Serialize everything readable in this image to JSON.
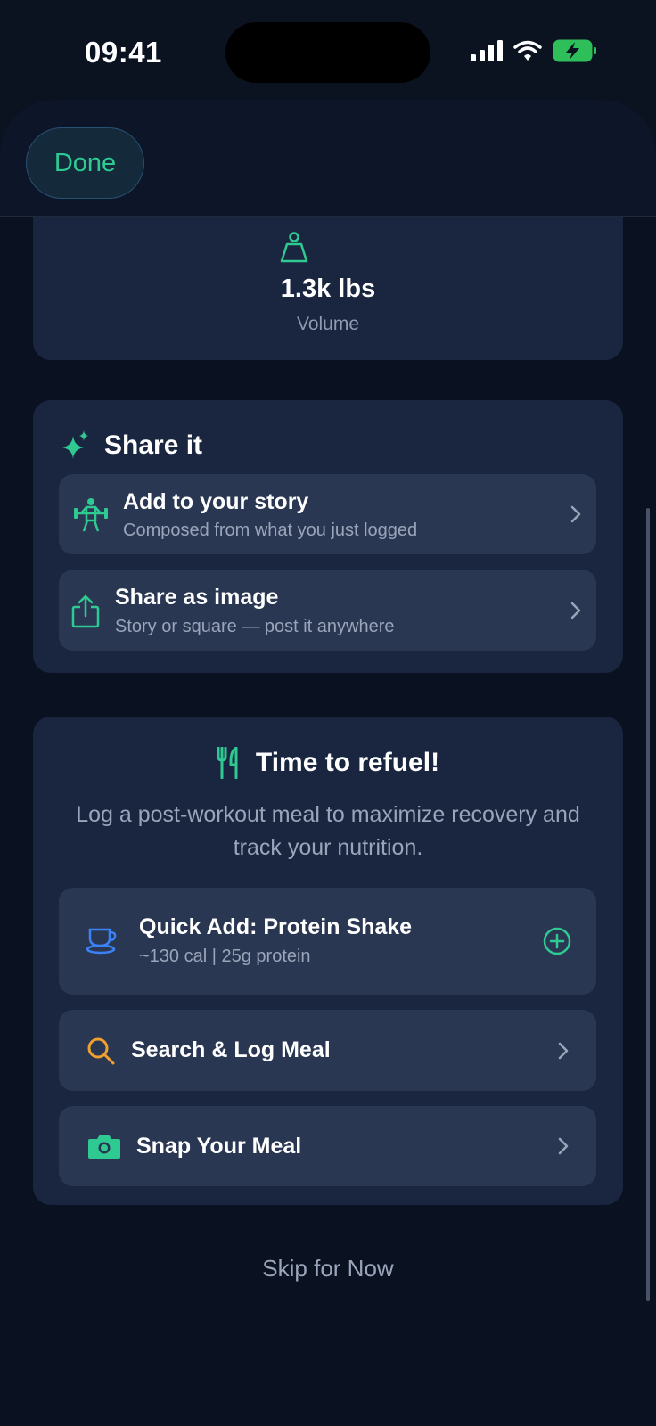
{
  "status": {
    "time": "09:41"
  },
  "header": {
    "done_label": "Done"
  },
  "volume": {
    "value": "1.3k lbs",
    "label": "Volume"
  },
  "share": {
    "title": "Share it",
    "story": {
      "title": "Add to your story",
      "subtitle": "Composed from what you just logged"
    },
    "image": {
      "title": "Share as image",
      "subtitle": "Story or square — post it anywhere"
    }
  },
  "refuel": {
    "title": "Time to refuel!",
    "description": "Log a post-workout meal to maximize recovery and track your nutrition.",
    "quick_add": {
      "title": "Quick Add: Protein Shake",
      "subtitle": "~130 cal | 25g protein"
    },
    "search": {
      "title": "Search & Log Meal"
    },
    "snap": {
      "title": "Snap Your Meal"
    }
  },
  "skip_label": "Skip for Now",
  "colors": {
    "accent": "#2fc992",
    "background": "#0b1220",
    "card": "#1a2640",
    "row": "#2a3752",
    "search_icon": "#f0a030",
    "cup_icon": "#3b82f6"
  },
  "icons": [
    "signal-icon",
    "wifi-icon",
    "battery-charging-icon",
    "kettlebell-icon",
    "sparkles-icon",
    "weightlifter-icon",
    "share-icon",
    "fork-knife-icon",
    "cup-icon",
    "plus-circle-icon",
    "search-icon",
    "camera-icon",
    "chevron-right-icon"
  ]
}
